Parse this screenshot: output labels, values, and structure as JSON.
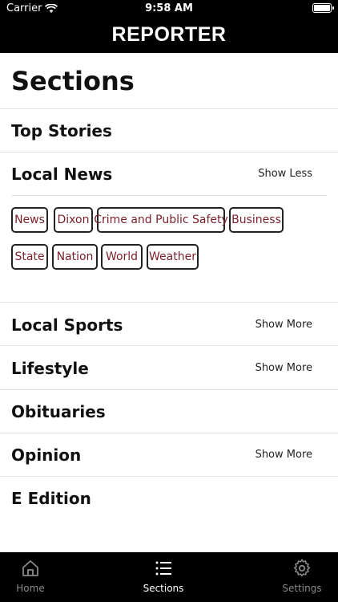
{
  "status": {
    "carrier": "Carrier",
    "time": "9:58 AM"
  },
  "header": {
    "logo": "REPORTER"
  },
  "page": {
    "title": "Sections"
  },
  "sections": [
    {
      "title": "Top Stories",
      "action": ""
    },
    {
      "title": "Local News",
      "action": "Show Less"
    },
    {
      "title": "Local Sports",
      "action": "Show More"
    },
    {
      "title": "Lifestyle",
      "action": "Show More"
    },
    {
      "title": "Obituaries",
      "action": ""
    },
    {
      "title": "Opinion",
      "action": "Show More"
    },
    {
      "title": "E Edition",
      "action": ""
    }
  ],
  "local_news_tags": [
    "News",
    "Dixon",
    "Crime and Public Safety",
    "Business",
    "State",
    "Nation",
    "World",
    "Weather"
  ],
  "tabbar": {
    "home": "Home",
    "sections": "Sections",
    "settings": "Settings"
  },
  "colors": {
    "chip_text": "#7a1f2a",
    "bar_bg": "#000000",
    "tab_inactive": "#8a8a8a"
  },
  "icons": {
    "home": "house-icon",
    "sections": "list-icon",
    "settings": "gear-icon",
    "wifi": "wifi-icon",
    "battery": "battery-icon"
  }
}
